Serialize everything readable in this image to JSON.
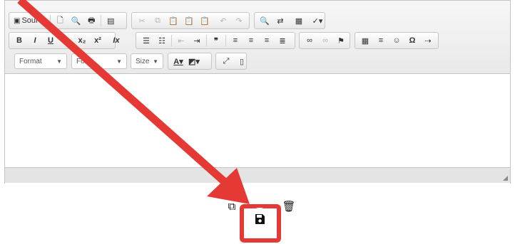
{
  "toolbar": {
    "source_label": "Source",
    "format_label": "Format",
    "font_label": "Font",
    "size_label": "Size"
  },
  "icons": {
    "copy": "copy-icon",
    "save": "floppy-disk-icon",
    "delete": "trash-icon"
  },
  "colors": {
    "annotation": "#e53935"
  }
}
